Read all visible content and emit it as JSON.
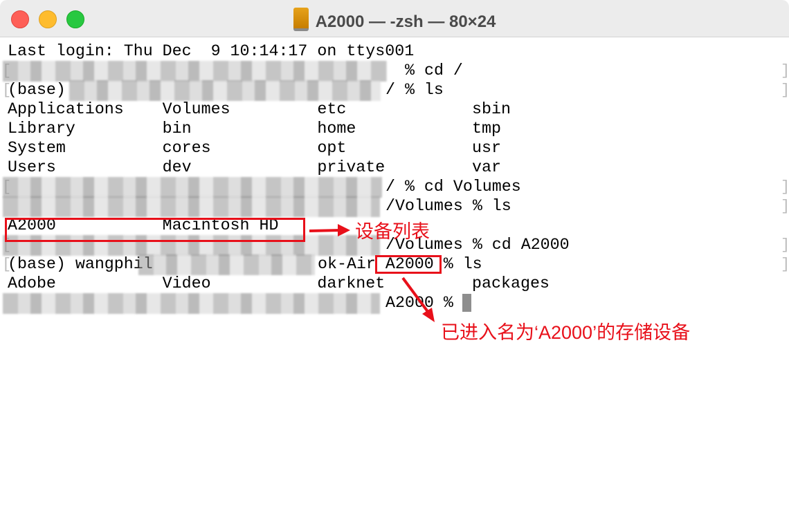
{
  "window": {
    "title": "A2000 — -zsh — 80×24",
    "title_icon": "external-disk-icon",
    "traffic_lights": {
      "close": "#fe5f57",
      "minimize": "#febc2e",
      "zoom": "#28c840"
    }
  },
  "terminal": {
    "lines": [
      "Last login: Thu Dec  9 10:14:17 on ttys001",
      "% cd /",
      "(base)",
      "/ % ls",
      "Applications    Volumes         etc             sbin",
      "Library         bin             home            tmp",
      "System          cores           opt             usr",
      "Users           dev             private         var",
      "/ % cd Volumes",
      "/Volumes % ls",
      "A2000           Macintosh HD",
      "/Volumes % cd A2000",
      "(base) wangphil",
      "ok-Air A2000 % ls",
      "Adobe           Video           darknet         packages",
      "A2000 % "
    ]
  },
  "annotations": {
    "color": "#e8101a",
    "device_list_label": "设备列表",
    "entered_device_label": "已进入名为‘A2000’的存储设备"
  }
}
